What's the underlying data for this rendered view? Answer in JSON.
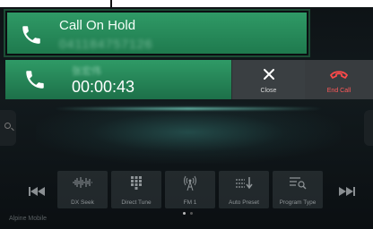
{
  "hold_banner": {
    "title": "Call On Hold",
    "number": "041184757126"
  },
  "active_call": {
    "caller": "张宏伟",
    "timer": "00:00:43"
  },
  "actions": {
    "close_label": "Close",
    "end_label": "End Call"
  },
  "controls": [
    {
      "label": "DX Seek",
      "icon": "waveform-icon"
    },
    {
      "label": "Direct Tune",
      "icon": "keypad-icon"
    },
    {
      "label": "FM 1",
      "icon": "antenna-icon"
    },
    {
      "label": "Auto Preset",
      "icon": "preset-list-icon"
    },
    {
      "label": "Program Type",
      "icon": "list-search-icon"
    }
  ],
  "brand": "Alpine Mobile",
  "colors": {
    "call_green": "#2f9a66",
    "end_red": "#ff5a5a",
    "background": "#0e1316"
  }
}
